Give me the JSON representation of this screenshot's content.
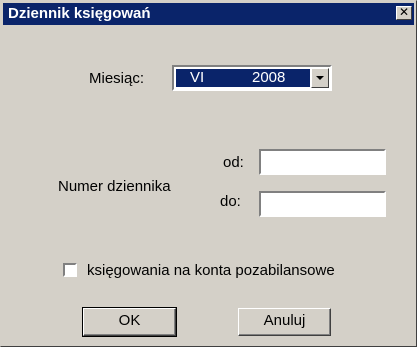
{
  "window": {
    "title": "Dziennik księgowań",
    "close_label": "✕"
  },
  "month": {
    "label": "Miesiąc:",
    "selected_month": "VI",
    "selected_year": "2008"
  },
  "journal_number": {
    "label": "Numer dziennika",
    "from_label": "od:",
    "to_label": "do:",
    "from_value": "",
    "to_value": ""
  },
  "off_balance": {
    "label": "księgowania na konta pozabilansowe",
    "checked": false
  },
  "buttons": {
    "ok": "OK",
    "cancel": "Anuluj"
  }
}
